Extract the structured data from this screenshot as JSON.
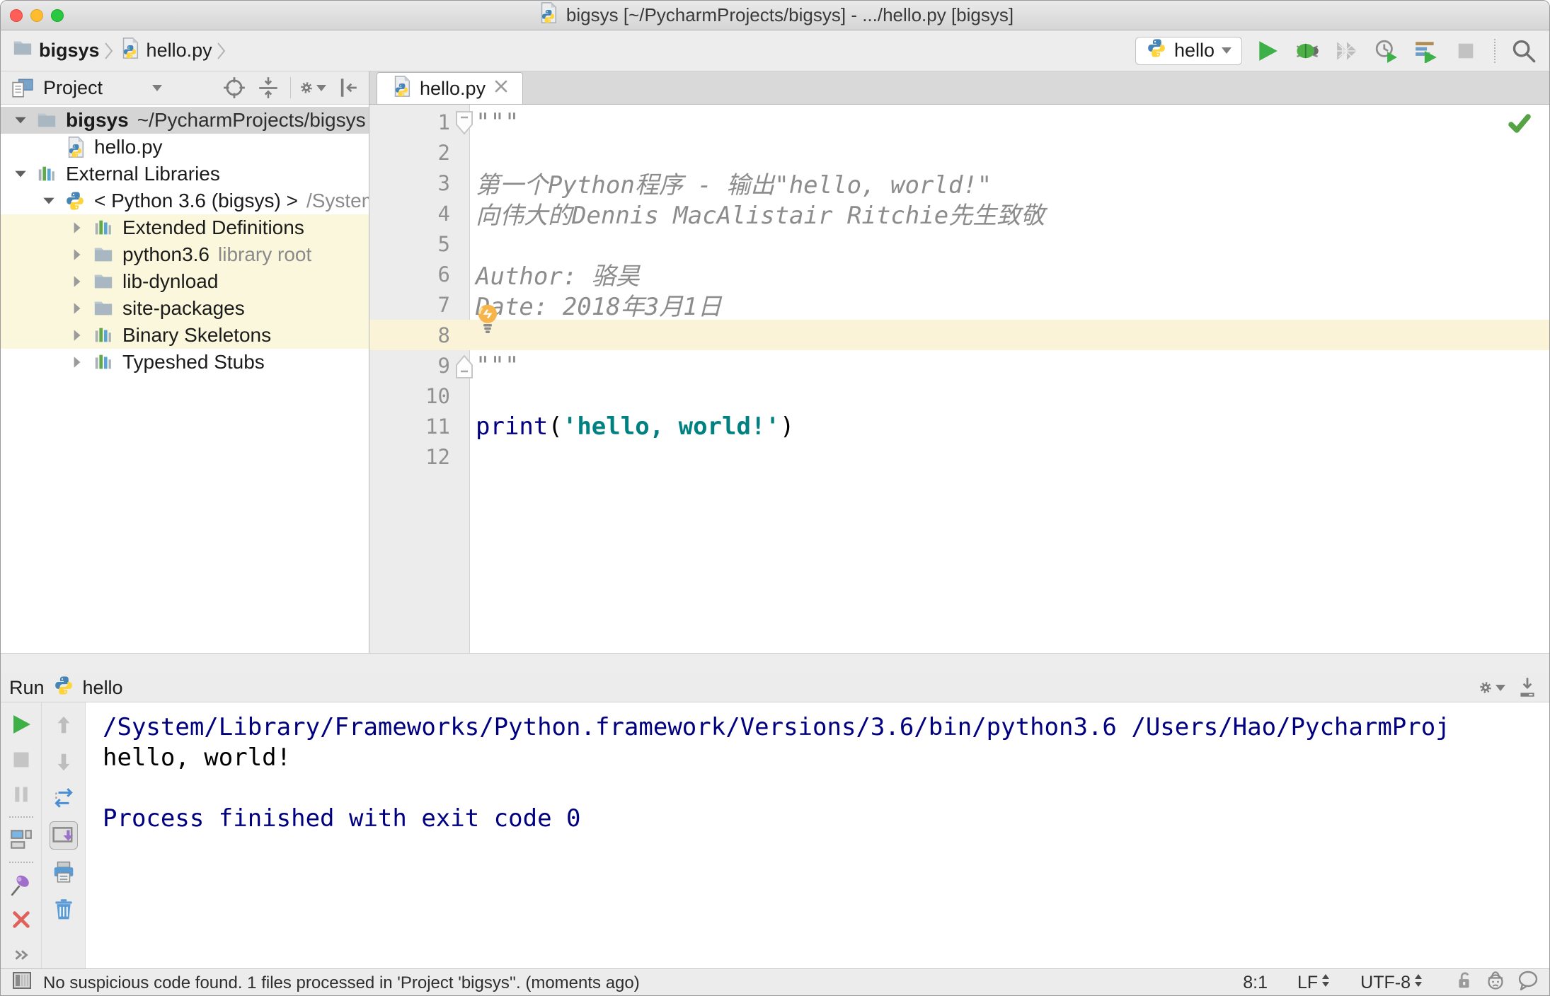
{
  "window": {
    "title": "bigsys [~/PycharmProjects/bigsys] - .../hello.py [bigsys]"
  },
  "toolbar": {
    "breadcrumbs": [
      {
        "label": "bigsys"
      },
      {
        "label": "hello.py"
      }
    ],
    "run_config": {
      "label": "hello"
    },
    "buttons": [
      "run",
      "debug",
      "run-with-coverage",
      "profile",
      "concurrency-diagram",
      "stop",
      "search-everywhere"
    ]
  },
  "project_panel": {
    "header": {
      "title": "Project",
      "icons": [
        "locate",
        "collapse-all",
        "settings",
        "hide-panel"
      ]
    },
    "tree": [
      {
        "label": "bigsys",
        "suffix": "~/PycharmProjects/bigsys",
        "icon": "folder",
        "chevron": "down",
        "level": 0,
        "bg": "selected",
        "bold": true,
        "suffix_dim": false
      },
      {
        "label": "hello.py",
        "suffix": "",
        "icon": "pyfile",
        "chevron": "none",
        "level": 1,
        "bg": "",
        "bold": false,
        "suffix_dim": true
      },
      {
        "label": "External Libraries",
        "suffix": "",
        "icon": "library",
        "chevron": "down",
        "level": 0,
        "bg": "",
        "bold": false,
        "suffix_dim": true
      },
      {
        "label": "< Python 3.6 (bigsys) >",
        "suffix": "/System",
        "icon": "python",
        "chevron": "down",
        "level": 1,
        "bg": "",
        "bold": false,
        "suffix_dim": true
      },
      {
        "label": "Extended Definitions",
        "suffix": "",
        "icon": "library",
        "chevron": "right",
        "level": 2,
        "bg": "highlight",
        "bold": false,
        "suffix_dim": true
      },
      {
        "label": "python3.6",
        "suffix": "library root",
        "icon": "folder",
        "chevron": "right",
        "level": 2,
        "bg": "highlight",
        "bold": false,
        "suffix_dim": true
      },
      {
        "label": "lib-dynload",
        "suffix": "",
        "icon": "folder",
        "chevron": "right",
        "level": 2,
        "bg": "highlight",
        "bold": false,
        "suffix_dim": true
      },
      {
        "label": "site-packages",
        "suffix": "",
        "icon": "folder",
        "chevron": "right",
        "level": 2,
        "bg": "highlight",
        "bold": false,
        "suffix_dim": true
      },
      {
        "label": "Binary Skeletons",
        "suffix": "",
        "icon": "library",
        "chevron": "right",
        "level": 2,
        "bg": "highlight",
        "bold": false,
        "suffix_dim": true
      },
      {
        "label": "Typeshed Stubs",
        "suffix": "",
        "icon": "library",
        "chevron": "right",
        "level": 2,
        "bg": "",
        "bold": false,
        "suffix_dim": true
      }
    ]
  },
  "editor": {
    "tab": {
      "label": "hello.py"
    },
    "active_line": 8,
    "lines": [
      {
        "n": 1,
        "segs": [
          {
            "t": "\"\"\"",
            "s": "doc"
          }
        ]
      },
      {
        "n": 2,
        "segs": []
      },
      {
        "n": 3,
        "segs": [
          {
            "t": "第一个Python程序 - 输出\"hello, world!\"",
            "s": "doc"
          }
        ]
      },
      {
        "n": 4,
        "segs": [
          {
            "t": "向伟大的Dennis MacAlistair Ritchie先生致敬",
            "s": "doc"
          }
        ]
      },
      {
        "n": 5,
        "segs": []
      },
      {
        "n": 6,
        "segs": [
          {
            "t": "Author: 骆昊",
            "s": "doc"
          }
        ]
      },
      {
        "n": 7,
        "segs": [
          {
            "t": "Date: 2018年3月1日",
            "s": "doc"
          }
        ]
      },
      {
        "n": 8,
        "segs": []
      },
      {
        "n": 9,
        "segs": [
          {
            "t": "\"\"\"",
            "s": "doc"
          }
        ]
      },
      {
        "n": 10,
        "segs": []
      },
      {
        "n": 11,
        "segs": [
          {
            "t": "print",
            "s": "kw"
          },
          {
            "t": "(",
            "s": "plain"
          },
          {
            "t": "'hello, world!'",
            "s": "str"
          },
          {
            "t": ")",
            "s": "plain"
          }
        ]
      },
      {
        "n": 12,
        "segs": []
      }
    ]
  },
  "run_panel": {
    "label": "Run",
    "config": "hello",
    "left_toolbar": [
      "rerun",
      "stop",
      "pause",
      "show-console",
      "pin-tab",
      "close",
      "more"
    ],
    "right_toolbar": [
      "up-stack-trace",
      "down-stack-trace",
      "soft-wrap",
      "scroll-to-end",
      "print",
      "clear-all"
    ],
    "console": [
      {
        "text": "/System/Library/Frameworks/Python.framework/Versions/3.6/bin/python3.6 /Users/Hao/PycharmProj",
        "stream": "system"
      },
      {
        "text": "hello, world!",
        "stream": "stdout"
      },
      {
        "text": "",
        "stream": "stdout"
      },
      {
        "text": "Process finished with exit code 0",
        "stream": "system"
      }
    ]
  },
  "status_bar": {
    "message": "No suspicious code found. 1 files processed in 'Project 'bigsys''. (moments ago)",
    "caret_position": "8:1",
    "line_separator": "LF",
    "encoding": "UTF-8",
    "icons": [
      "lock",
      "hector",
      "feedback-bubble"
    ]
  },
  "colors": {
    "keyword": "#000080",
    "string": "#008080",
    "docstring": "#8c8c8c",
    "console_system": "#000080",
    "run_green": "#3db148",
    "highlight_row": "#fbf7dc",
    "current_line": "#fbf3d8"
  }
}
